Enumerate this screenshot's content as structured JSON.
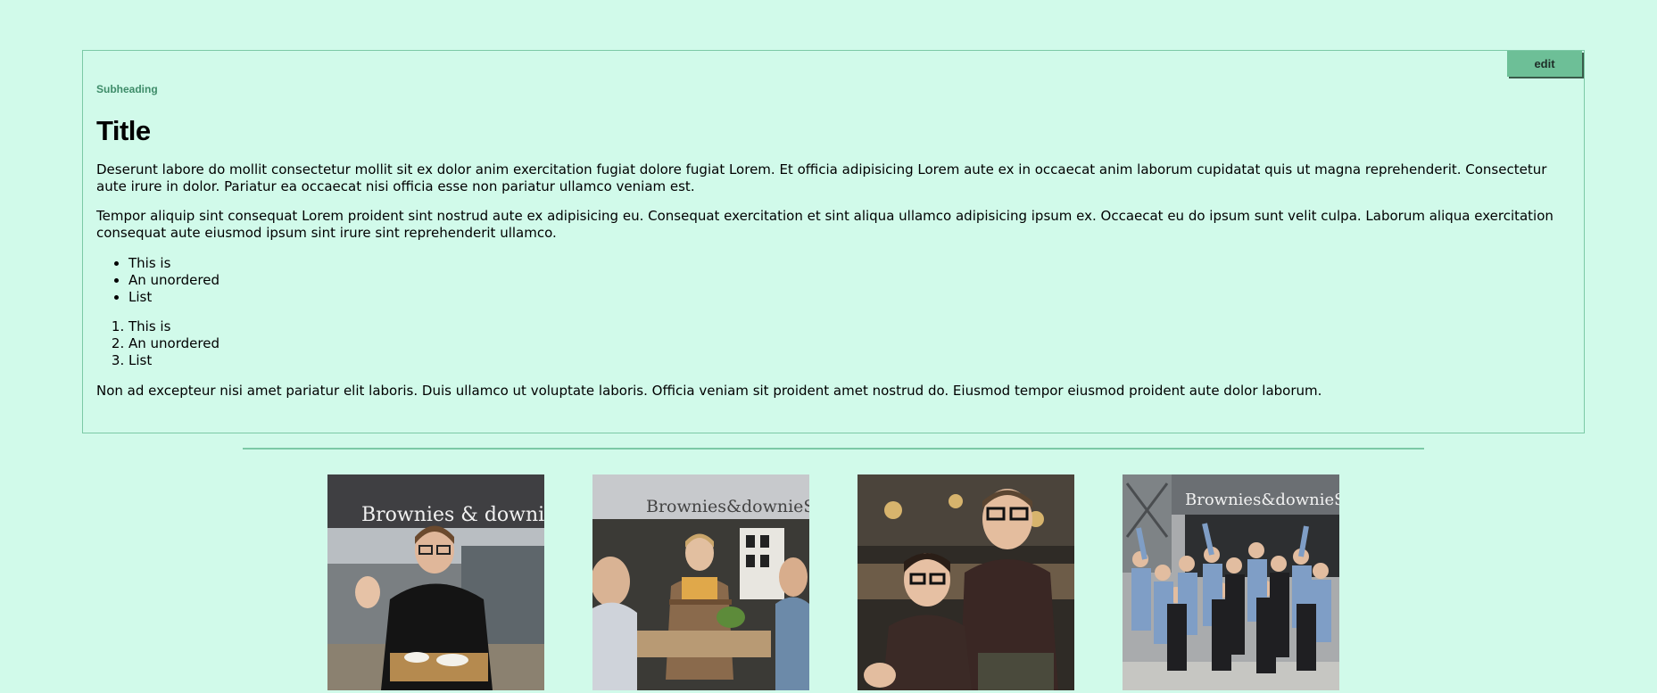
{
  "card": {
    "edit_label": "edit",
    "subheading": "Subheading",
    "title": "Title",
    "paragraphs": [
      "Deserunt labore do mollit consectetur mollit sit ex dolor anim exercitation fugiat dolore fugiat Lorem. Et officia adipisicing Lorem aute ex in occaecat anim laborum cupidatat quis ut magna reprehenderit. Consectetur aute irure in dolor. Pariatur ea occaecat nisi officia esse non pariatur ullamco veniam est.",
      "Tempor aliquip sint consequat Lorem proident sint nostrud aute ex adipisicing eu. Consequat exercitation et sint aliqua ullamco adipisicing ipsum ex. Occaecat eu do ipsum sunt velit culpa. Laborum aliqua exercitation consequat aute eiusmod ipsum sint irure sint reprehenderit ullamco."
    ],
    "unordered_list": [
      "This is",
      "An unordered",
      "List"
    ],
    "ordered_list": [
      "This is",
      "An unordered",
      "List"
    ],
    "closing_paragraph": "Non ad excepteur nisi amet pariatur elit laboris. Duis ullamco ut voluptate laboris. Officia veniam sit proident amet nostrud do. Eiusmod tempor eiusmod proident aute dolor laborum."
  },
  "gallery": {
    "sign_text": "Brownies & downieS",
    "images": [
      {
        "name": "photo-waiter-with-tray"
      },
      {
        "name": "photo-server-with-drinks"
      },
      {
        "name": "photo-two-staff-members"
      },
      {
        "name": "photo-team-group-outside-store"
      }
    ]
  },
  "colors": {
    "background": "#d1faea",
    "accent": "#6dbf97",
    "border": "#7cc9a6",
    "subheading": "#3e8c69"
  }
}
